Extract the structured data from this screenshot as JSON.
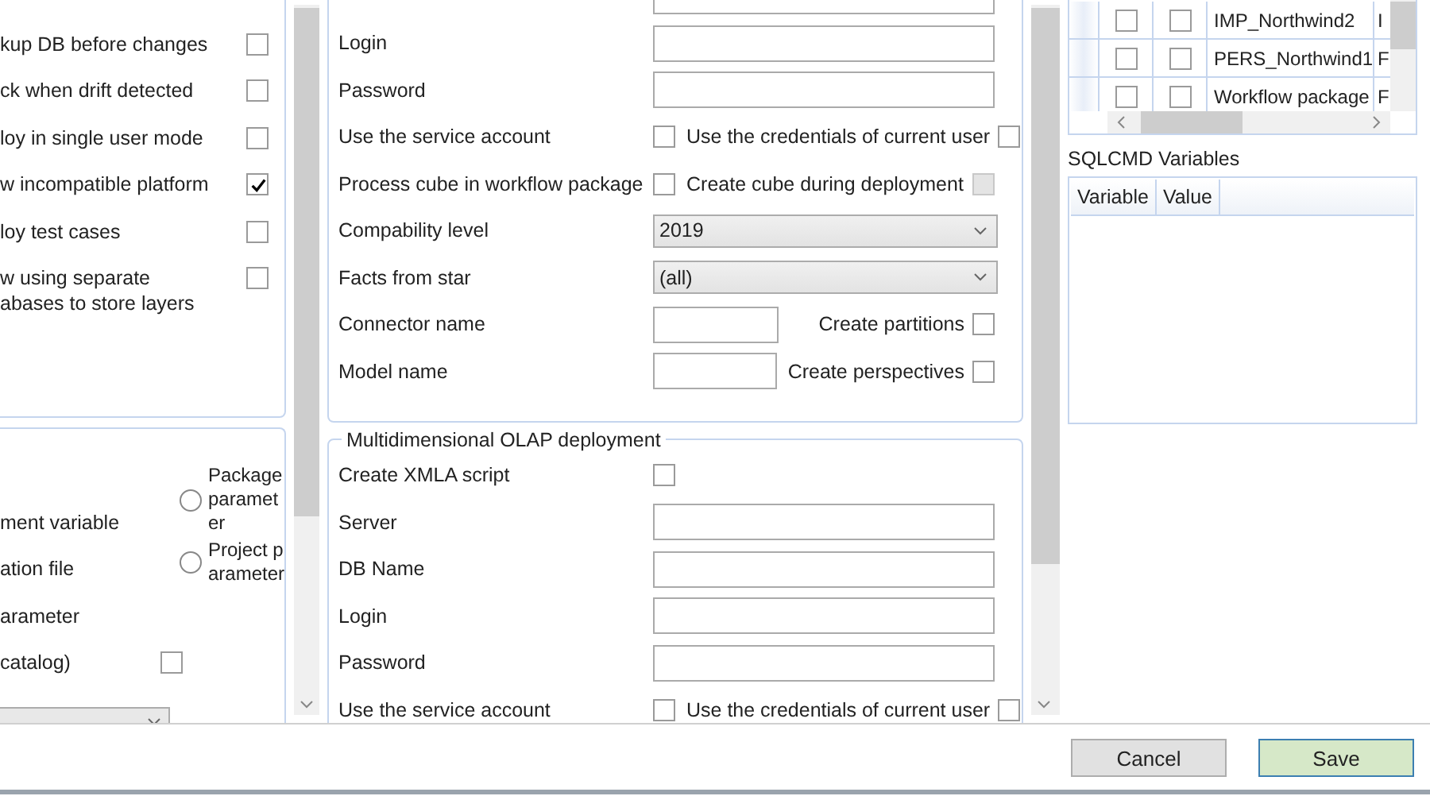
{
  "left_panel": {
    "options": [
      {
        "label": "kup DB before changes",
        "checked": false
      },
      {
        "label": "ck when drift detected",
        "checked": false
      },
      {
        "label": "loy in single user mode",
        "checked": false
      },
      {
        "label": "w incompatible platform",
        "checked": true
      },
      {
        "label": "loy test cases",
        "checked": false
      },
      {
        "label": "w using separate abases to store layers",
        "checked": false
      }
    ],
    "source_rows": [
      {
        "kind": "text",
        "label": "ment variable"
      },
      {
        "kind": "text",
        "label": "ation file"
      },
      {
        "kind": "text",
        "label": "arameter"
      },
      {
        "kind": "check",
        "label": "catalog)",
        "checked": false
      },
      {
        "kind": "select"
      }
    ],
    "radios": [
      {
        "label": "Package parameter",
        "selected": false
      },
      {
        "label": "Project parameter",
        "selected": false
      }
    ]
  },
  "tabular_group": {
    "rows": [
      {
        "kind": "field"
      },
      {
        "kind": "field",
        "label": "Login"
      },
      {
        "kind": "field",
        "label": "Password"
      },
      {
        "kind": "check_pair",
        "label": "Use the service account",
        "checked": false,
        "label2": "Use the credentials of current user",
        "checked2": false,
        "disabled2": false
      },
      {
        "kind": "check_pair",
        "label": "Process cube in workflow package",
        "checked": false,
        "label2": "Create cube during deployment",
        "checked2": false,
        "disabled2": true
      },
      {
        "kind": "select",
        "label": "Compability level",
        "value": "2019"
      },
      {
        "kind": "select",
        "label": "Facts from star",
        "value": "(all)"
      },
      {
        "kind": "small_field",
        "label": "Connector name",
        "label2": "Create partitions",
        "checked2": false
      },
      {
        "kind": "small_field",
        "label": "Model name",
        "label2": "Create perspectives",
        "checked2": false
      }
    ]
  },
  "olap_group": {
    "title": "Multidimensional OLAP deployment",
    "rows": [
      {
        "kind": "check",
        "label": "Create XMLA script",
        "checked": false
      },
      {
        "kind": "field",
        "label": "Server"
      },
      {
        "kind": "field",
        "label": "DB Name"
      },
      {
        "kind": "field",
        "label": "Login"
      },
      {
        "kind": "field",
        "label": "Password"
      },
      {
        "kind": "check_pair",
        "label": "Use the service account",
        "checked": false,
        "label2": "Use the credentials of current user",
        "checked2": false,
        "disabled2": false
      }
    ]
  },
  "packages_table": {
    "rows": [
      {
        "column_a": false,
        "column_b": false,
        "name": "IMP_Northwind2",
        "column_5": "I"
      },
      {
        "column_a": false,
        "column_b": false,
        "name": "PERS_Northwind1",
        "column_5": "F"
      },
      {
        "column_a": false,
        "column_b": false,
        "name": "Workflow package",
        "column_5": "F"
      }
    ]
  },
  "sqlcmd": {
    "title": "SQLCMD Variables",
    "columns": [
      "Variable",
      "Value"
    ]
  },
  "buttons": [
    {
      "label": "Cancel",
      "focused": false
    },
    {
      "label": "Save",
      "focused": true
    }
  ]
}
